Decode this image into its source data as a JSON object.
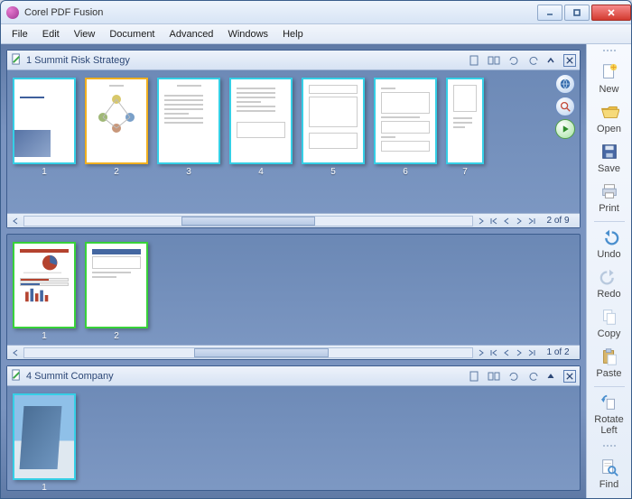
{
  "app": {
    "title": "Corel PDF Fusion"
  },
  "menu": [
    "File",
    "Edit",
    "View",
    "Document",
    "Advanced",
    "Windows",
    "Help"
  ],
  "sidebar": {
    "items": [
      {
        "label": "New"
      },
      {
        "label": "Open"
      },
      {
        "label": "Save"
      },
      {
        "label": "Print"
      },
      {
        "label": "Undo"
      },
      {
        "label": "Redo"
      },
      {
        "label": "Copy"
      },
      {
        "label": "Paste"
      },
      {
        "label": "Rotate Left"
      },
      {
        "label": "Find"
      }
    ]
  },
  "panels": [
    {
      "title": "1 Summit Risk Strategy",
      "pager": "2 of 9",
      "thumbs": [
        {
          "n": "1"
        },
        {
          "n": "2"
        },
        {
          "n": "3"
        },
        {
          "n": "4"
        },
        {
          "n": "5"
        },
        {
          "n": "6"
        },
        {
          "n": "7"
        }
      ]
    },
    {
      "title": "",
      "pager": "1 of 2",
      "thumbs": [
        {
          "n": "1"
        },
        {
          "n": "2"
        }
      ]
    },
    {
      "title": "4 Summit Company",
      "pager": "",
      "thumbs": [
        {
          "n": "1"
        }
      ]
    }
  ]
}
